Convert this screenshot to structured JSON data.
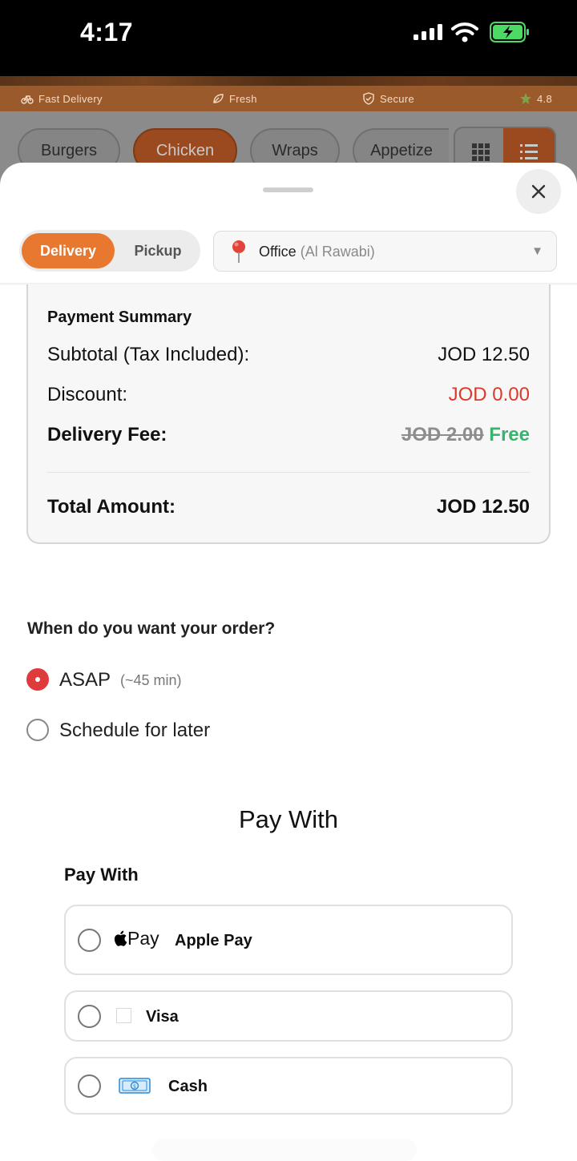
{
  "status_bar": {
    "time": "4:17"
  },
  "background": {
    "features": [
      {
        "label": "Fast Delivery",
        "icon": "bicycle-icon"
      },
      {
        "label": "Fresh",
        "icon": "leaf-icon"
      },
      {
        "label": "Secure",
        "icon": "shield-icon"
      },
      {
        "label": "4.8",
        "icon": "star-icon"
      }
    ],
    "categories": [
      {
        "label": "Burgers"
      },
      {
        "label": "Chicken",
        "active": true
      },
      {
        "label": "Wraps"
      },
      {
        "label": "Appetize"
      }
    ]
  },
  "sheet": {
    "order_type": {
      "delivery": "Delivery",
      "pickup": "Pickup",
      "selected": "Delivery"
    },
    "address": {
      "name": "Office",
      "detail": "(Al Rawabi)"
    },
    "summary": {
      "title": "Payment Summary",
      "subtotal_label": "Subtotal (Tax Included):",
      "subtotal_value": "JOD 12.50",
      "discount_label": "Discount:",
      "discount_value": "JOD 0.00",
      "delivery_label": "Delivery Fee:",
      "delivery_old": "JOD 2.00",
      "delivery_new": "Free",
      "total_label": "Total Amount:",
      "total_value": "JOD 12.50"
    },
    "timing": {
      "title": "When do you want your order?",
      "asap_label": "ASAP",
      "asap_hint": "(~45 min)",
      "schedule_label": "Schedule for later",
      "selected": "ASAP"
    },
    "payment": {
      "heading": "Pay With",
      "subheading": "Pay With",
      "apple_logo": "Pay",
      "apple_label": "Apple Pay",
      "visa_label": "Visa",
      "cash_label": "Cash"
    }
  },
  "colors": {
    "accent": "#e8772f",
    "danger": "#d93a2b",
    "success": "#37b56e"
  }
}
